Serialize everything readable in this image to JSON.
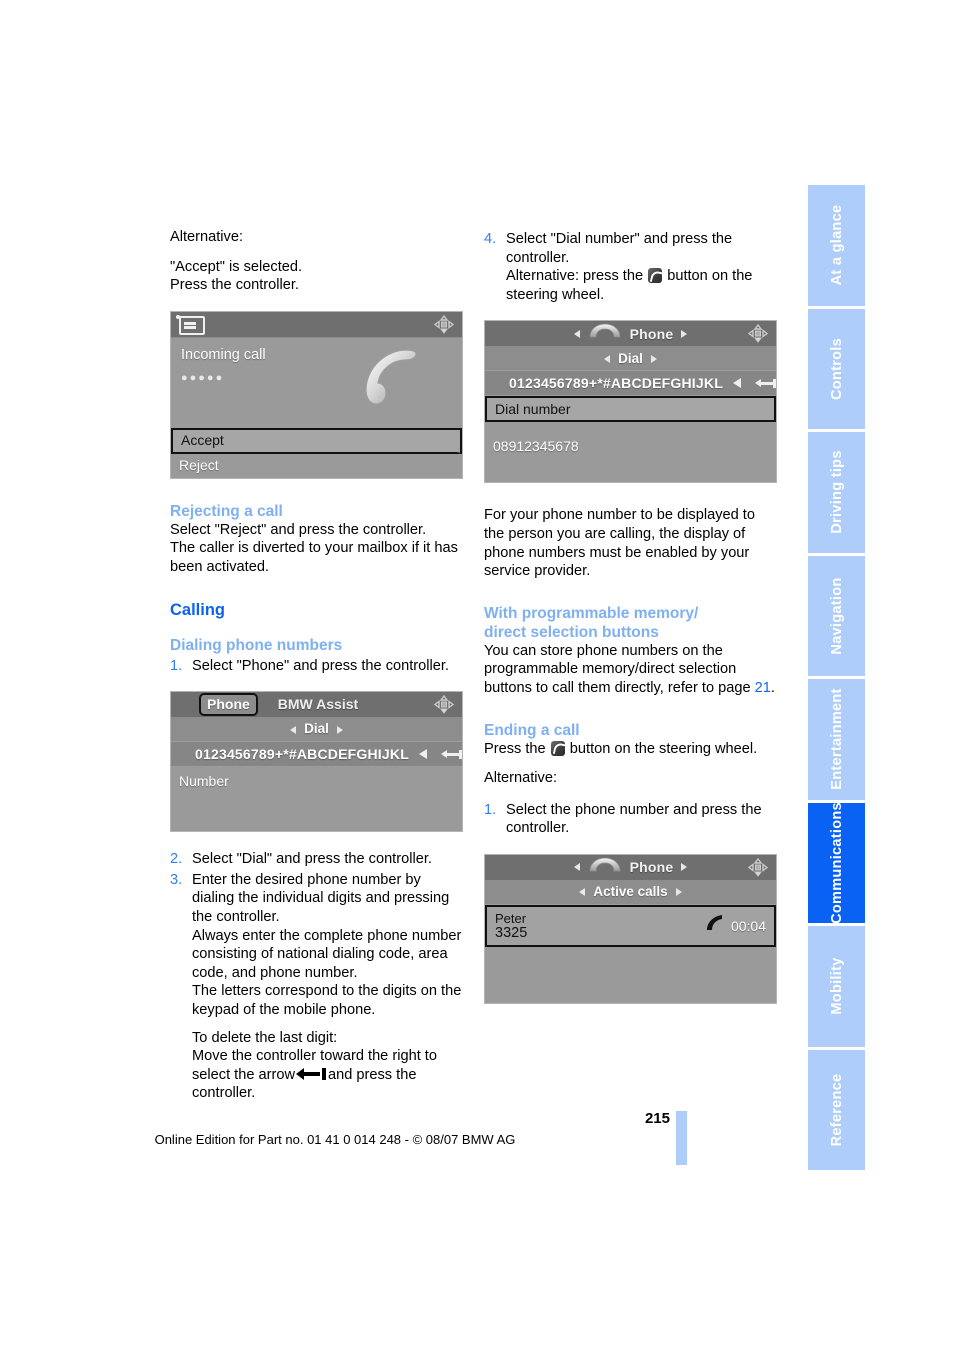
{
  "page": {
    "number": "215",
    "footer_note": "Online Edition for Part no. 01 41 0 014 248 - © 08/07 BMW AG"
  },
  "side_nav": {
    "items": [
      {
        "label": "At a glance",
        "active": false
      },
      {
        "label": "Controls",
        "active": false
      },
      {
        "label": "Driving tips",
        "active": false
      },
      {
        "label": "Navigation",
        "active": false
      },
      {
        "label": "Entertainment",
        "active": false
      },
      {
        "label": "Communications",
        "active": true
      },
      {
        "label": "Mobility",
        "active": false
      },
      {
        "label": "Reference",
        "active": false
      }
    ],
    "active_color": "#0a62f5",
    "inactive_color": "#aecdfb"
  },
  "left_column": {
    "alt_label": "Alternative:",
    "accept_selected": "\"Accept\" is selected.",
    "press_controller": "Press the controller.",
    "screenshot_incoming": {
      "caption": "Incoming call",
      "dots": "●●●●●",
      "accept_label": "Accept",
      "reject_label": "Reject"
    },
    "rejecting_head": "Rejecting a call",
    "rejecting_line1": "Select \"Reject\" and press the controller.",
    "rejecting_line2": "The caller is diverted to your mailbox if it has been activated.",
    "calling_head": "Calling",
    "dialing_head": "Dialing phone numbers",
    "step1_num": "1.",
    "step1_text": "Select \"Phone\" and press the controller.",
    "screenshot_dial": {
      "tab_phone": "Phone",
      "tab_bmw_assist": "BMW Assist",
      "subbar": "Dial",
      "charset": "0123456789+*#ABCDEFGHIJKL",
      "number_label": "Number"
    },
    "step2_num": "2.",
    "step2_text": "Select \"Dial\" and press the controller.",
    "step3_num": "3.",
    "step3_p1": "Enter the desired phone number by dialing the individual digits and pressing the controller.",
    "step3_p2": "Always enter the complete phone number consisting of national dialing code, area code, and phone number.",
    "step3_p3": "The letters correspond to the digits on the keypad of the mobile phone.",
    "step3_p4a": "To delete the last digit:",
    "step3_p4b": "Move the controller toward the right to select the arrow",
    "step3_p4c": "and press the controller."
  },
  "right_column": {
    "step4_num": "4.",
    "step4_p1": "Select \"Dial number\" and press the controller.",
    "step4_p2a": "Alternative: press the",
    "step4_p2b": "button on the steering wheel.",
    "screenshot_dial_number": {
      "title": "Phone",
      "subbar": "Dial",
      "charset": "0123456789+*#ABCDEFGHIJKL",
      "dial_number_label": "Dial number",
      "entered_number": "08912345678"
    },
    "note": "For your phone number to be displayed to the person you are calling, the display of phone numbers must be enabled by your service provider.",
    "memory_head_line1": "With programmable memory/",
    "memory_head_line2": "direct selection buttons",
    "memory_text_a": "You can store phone numbers on the programmable memory/direct selection buttons to call them directly, refer to page",
    "memory_page_ref": "21",
    "memory_text_b": ".",
    "ending_head": "Ending a call",
    "ending_a": "Press the",
    "ending_b": "button on the steering wheel.",
    "alt_label": "Alternative:",
    "step1_num": "1.",
    "step1_text": "Select the phone number and press the controller.",
    "screenshot_active": {
      "title": "Phone",
      "subbar": "Active calls",
      "contact_name": "Peter",
      "contact_number": "3325",
      "duration": "00:04"
    }
  }
}
